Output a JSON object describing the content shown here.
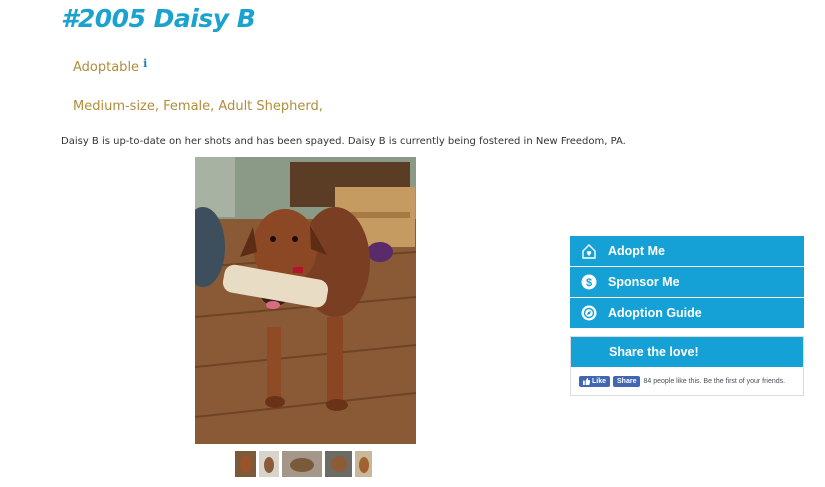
{
  "pet": {
    "title": "#2005 Daisy B",
    "status": "Adoptable",
    "info_icon": "i",
    "attributes": "Medium-size, Female, Adult Shepherd,",
    "description": "Daisy B is up-to-date on her shots and has been spayed. Daisy B is currently being fostered in New Freedom, PA."
  },
  "photo": {
    "subject": "brown dog holding bone",
    "thumbnail_count": 5
  },
  "sidebar": {
    "items": [
      {
        "label": "Adopt Me",
        "icon": "house-heart-icon"
      },
      {
        "label": "Sponsor Me",
        "icon": "dollar-icon"
      },
      {
        "label": "Adoption Guide",
        "icon": "compass-icon"
      }
    ],
    "share_title": "Share the love!",
    "fb_like": "Like",
    "fb_share": "Share",
    "fb_text": "84 people like this. Be the first of your friends."
  },
  "colors": {
    "accent": "#15a1d6",
    "title": "#1aa3cf",
    "gold": "#b08d3b",
    "facebook": "#4267b2"
  }
}
